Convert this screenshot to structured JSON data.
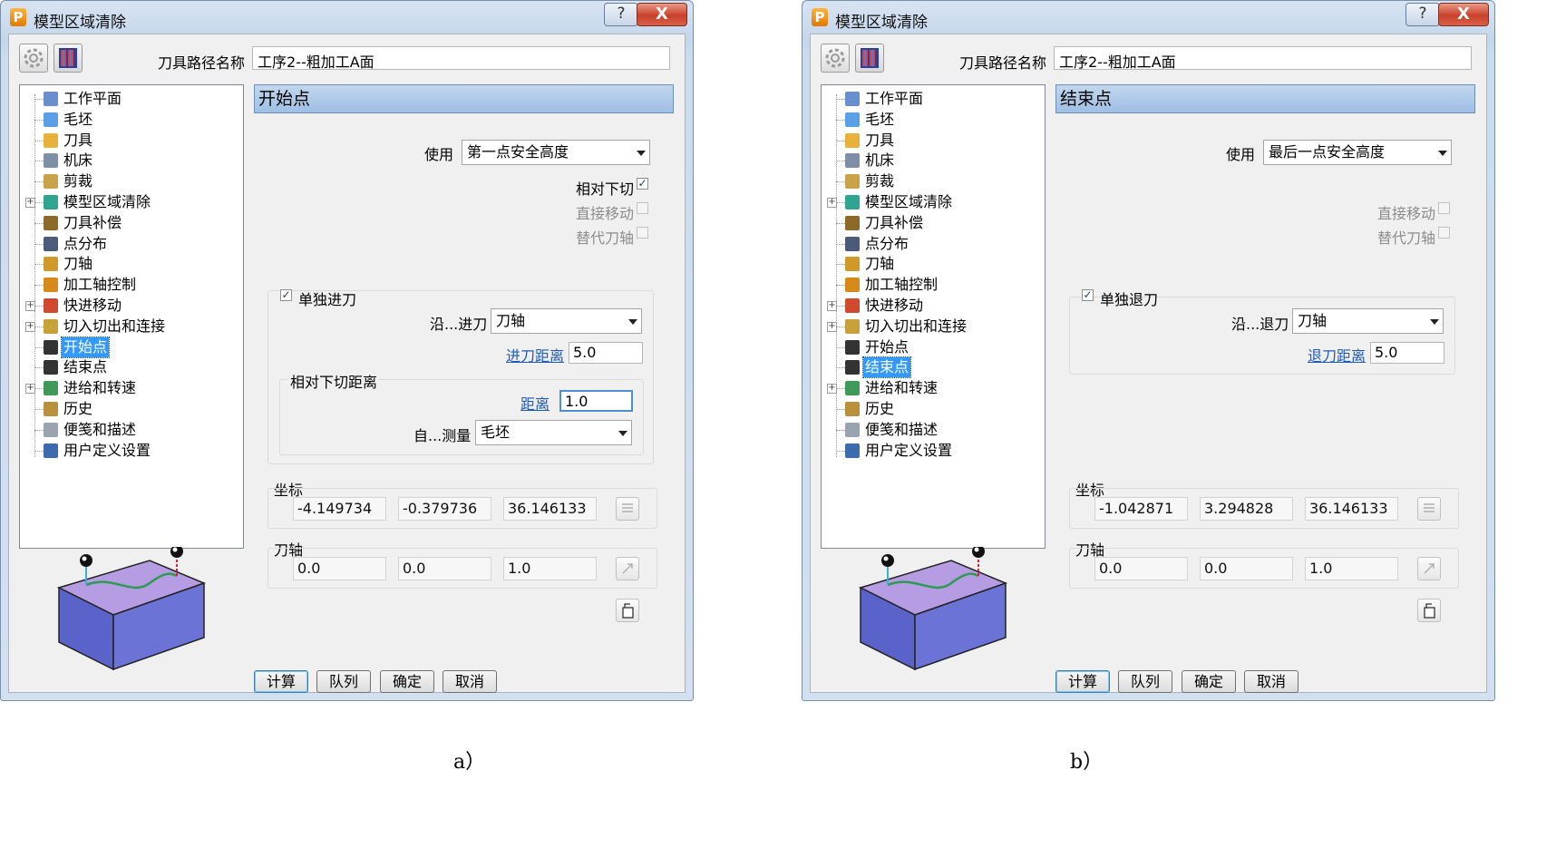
{
  "figure_a": {
    "caption": "a）",
    "title": "模型区域清除",
    "help_label": "?",
    "close_label": "X",
    "toolpath_name_label": "刀具路径名称",
    "toolpath_name_value": "工序2--粗加工A面",
    "tree": [
      {
        "label": "工作平面",
        "icon": "workplane-icon",
        "expandable": false,
        "selected": false
      },
      {
        "label": "毛坯",
        "icon": "stock-block-icon",
        "expandable": false,
        "selected": false
      },
      {
        "label": "刀具",
        "icon": "tool-icon",
        "expandable": false,
        "selected": false
      },
      {
        "label": "机床",
        "icon": "machine-icon",
        "expandable": false,
        "selected": false
      },
      {
        "label": "剪裁",
        "icon": "trim-icon",
        "expandable": false,
        "selected": false
      },
      {
        "label": "模型区域清除",
        "icon": "area-clear-icon",
        "expandable": true,
        "selected": false
      },
      {
        "label": "刀具补偿",
        "icon": "tool-compensation-icon",
        "expandable": false,
        "selected": false
      },
      {
        "label": "点分布",
        "icon": "point-distribution-icon",
        "expandable": false,
        "selected": false
      },
      {
        "label": "刀轴",
        "icon": "tool-axis-icon",
        "expandable": false,
        "selected": false
      },
      {
        "label": "加工轴控制",
        "icon": "axis-control-icon",
        "expandable": false,
        "selected": false
      },
      {
        "label": "快进移动",
        "icon": "rapid-move-icon",
        "expandable": true,
        "selected": false
      },
      {
        "label": "切入切出和连接",
        "icon": "leads-links-icon",
        "expandable": true,
        "selected": false
      },
      {
        "label": "开始点",
        "icon": "start-point-icon",
        "expandable": false,
        "selected": true
      },
      {
        "label": "结束点",
        "icon": "end-point-icon",
        "expandable": false,
        "selected": false
      },
      {
        "label": "进给和转速",
        "icon": "feeds-speeds-icon",
        "expandable": true,
        "selected": false
      },
      {
        "label": "历史",
        "icon": "history-icon",
        "expandable": false,
        "selected": false
      },
      {
        "label": "便笺和描述",
        "icon": "notes-icon",
        "expandable": false,
        "selected": false
      },
      {
        "label": "用户定义设置",
        "icon": "user-settings-icon",
        "expandable": false,
        "selected": false
      }
    ],
    "panel_title": "开始点",
    "use_label": "使用",
    "use_value": "第一点安全高度",
    "rel_plunge_label": "相对下切",
    "rel_plunge_checked": "✓",
    "direct_move_label": "直接移动",
    "alt_axis_label": "替代刀轴",
    "separate_label": "单独进刀",
    "separate_checked": "✓",
    "along_label": "沿...进刀",
    "along_value": "刀轴",
    "dist_label": "进刀距离",
    "dist_value": "5.0",
    "rel_group_label": "相对下切距离",
    "distance_label": "距离",
    "distance_value": "1.0",
    "measure_label": "自...测量",
    "measure_value": "毛坯",
    "coord_label": "坐标",
    "coords": [
      "-4.149734",
      "-0.379736",
      "36.146133"
    ],
    "axis_label": "刀轴",
    "axis_values": [
      "0.0",
      "0.0",
      "1.0"
    ],
    "buttons": {
      "calc": "计算",
      "queue": "队列",
      "ok": "确定",
      "cancel": "取消"
    }
  },
  "figure_b": {
    "caption": "b）",
    "title": "模型区域清除",
    "help_label": "?",
    "close_label": "X",
    "toolpath_name_label": "刀具路径名称",
    "toolpath_name_value": "工序2--粗加工A面",
    "tree": [
      {
        "label": "工作平面",
        "icon": "workplane-icon",
        "expandable": false,
        "selected": false
      },
      {
        "label": "毛坯",
        "icon": "stock-block-icon",
        "expandable": false,
        "selected": false
      },
      {
        "label": "刀具",
        "icon": "tool-icon",
        "expandable": false,
        "selected": false
      },
      {
        "label": "机床",
        "icon": "machine-icon",
        "expandable": false,
        "selected": false
      },
      {
        "label": "剪裁",
        "icon": "trim-icon",
        "expandable": false,
        "selected": false
      },
      {
        "label": "模型区域清除",
        "icon": "area-clear-icon",
        "expandable": true,
        "selected": false
      },
      {
        "label": "刀具补偿",
        "icon": "tool-compensation-icon",
        "expandable": false,
        "selected": false
      },
      {
        "label": "点分布",
        "icon": "point-distribution-icon",
        "expandable": false,
        "selected": false
      },
      {
        "label": "刀轴",
        "icon": "tool-axis-icon",
        "expandable": false,
        "selected": false
      },
      {
        "label": "加工轴控制",
        "icon": "axis-control-icon",
        "expandable": false,
        "selected": false
      },
      {
        "label": "快进移动",
        "icon": "rapid-move-icon",
        "expandable": true,
        "selected": false
      },
      {
        "label": "切入切出和连接",
        "icon": "leads-links-icon",
        "expandable": true,
        "selected": false
      },
      {
        "label": "开始点",
        "icon": "start-point-icon",
        "expandable": false,
        "selected": false
      },
      {
        "label": "结束点",
        "icon": "end-point-icon",
        "expandable": false,
        "selected": true
      },
      {
        "label": "进给和转速",
        "icon": "feeds-speeds-icon",
        "expandable": true,
        "selected": false
      },
      {
        "label": "历史",
        "icon": "history-icon",
        "expandable": false,
        "selected": false
      },
      {
        "label": "便笺和描述",
        "icon": "notes-icon",
        "expandable": false,
        "selected": false
      },
      {
        "label": "用户定义设置",
        "icon": "user-settings-icon",
        "expandable": false,
        "selected": false
      }
    ],
    "panel_title": "结束点",
    "use_label": "使用",
    "use_value": "最后一点安全高度",
    "direct_move_label": "直接移动",
    "alt_axis_label": "替代刀轴",
    "separate_label": "单独退刀",
    "separate_checked": "✓",
    "along_label": "沿...退刀",
    "along_value": "刀轴",
    "dist_label": "退刀距离",
    "dist_value": "5.0",
    "coord_label": "坐标",
    "coords": [
      "-1.042871",
      "3.294828",
      "36.146133"
    ],
    "axis_label": "刀轴",
    "axis_values": [
      "0.0",
      "0.0",
      "1.0"
    ],
    "buttons": {
      "calc": "计算",
      "queue": "队列",
      "ok": "确定",
      "cancel": "取消"
    }
  }
}
